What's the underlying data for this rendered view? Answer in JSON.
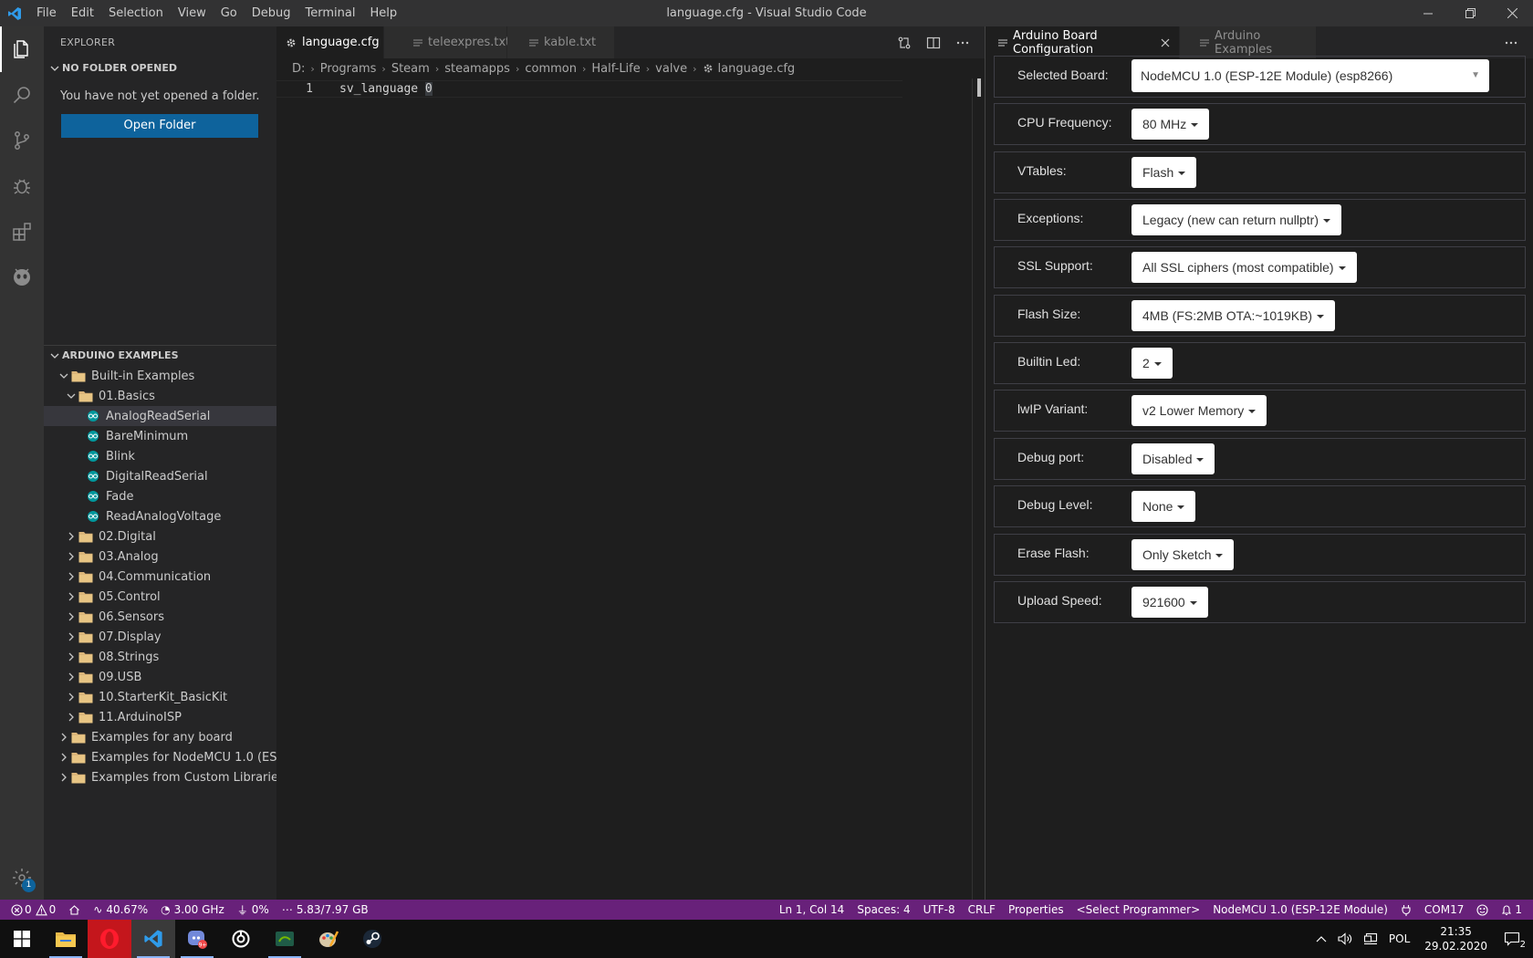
{
  "window": {
    "title": "language.cfg - Visual Studio Code",
    "menu": [
      "File",
      "Edit",
      "Selection",
      "View",
      "Go",
      "Debug",
      "Terminal",
      "Help"
    ]
  },
  "activity_bar": {
    "items": [
      "files-icon",
      "search-icon",
      "source-control-icon",
      "debug-icon",
      "extensions-icon",
      "platformio-icon"
    ],
    "settings_badge": "1"
  },
  "sidebar": {
    "title": "EXPLORER",
    "no_folder": {
      "header": "NO FOLDER OPENED",
      "message": "You have not yet opened a folder.",
      "button": "Open Folder"
    },
    "examples": {
      "header": "ARDUINO EXAMPLES",
      "tree": [
        {
          "label": "Built-in Examples",
          "depth": 0,
          "twisty": "open",
          "icon": "folder"
        },
        {
          "label": "01.Basics",
          "depth": 1,
          "twisty": "open",
          "icon": "folder"
        },
        {
          "label": "AnalogReadSerial",
          "depth": 2,
          "twisty": "none",
          "icon": "arduino",
          "selected": true
        },
        {
          "label": "BareMinimum",
          "depth": 2,
          "twisty": "none",
          "icon": "arduino"
        },
        {
          "label": "Blink",
          "depth": 2,
          "twisty": "none",
          "icon": "arduino"
        },
        {
          "label": "DigitalReadSerial",
          "depth": 2,
          "twisty": "none",
          "icon": "arduino"
        },
        {
          "label": "Fade",
          "depth": 2,
          "twisty": "none",
          "icon": "arduino"
        },
        {
          "label": "ReadAnalogVoltage",
          "depth": 2,
          "twisty": "none",
          "icon": "arduino"
        },
        {
          "label": "02.Digital",
          "depth": 1,
          "twisty": "closed",
          "icon": "folder"
        },
        {
          "label": "03.Analog",
          "depth": 1,
          "twisty": "closed",
          "icon": "folder"
        },
        {
          "label": "04.Communication",
          "depth": 1,
          "twisty": "closed",
          "icon": "folder"
        },
        {
          "label": "05.Control",
          "depth": 1,
          "twisty": "closed",
          "icon": "folder"
        },
        {
          "label": "06.Sensors",
          "depth": 1,
          "twisty": "closed",
          "icon": "folder"
        },
        {
          "label": "07.Display",
          "depth": 1,
          "twisty": "closed",
          "icon": "folder"
        },
        {
          "label": "08.Strings",
          "depth": 1,
          "twisty": "closed",
          "icon": "folder"
        },
        {
          "label": "09.USB",
          "depth": 1,
          "twisty": "closed",
          "icon": "folder"
        },
        {
          "label": "10.StarterKit_BasicKit",
          "depth": 1,
          "twisty": "closed",
          "icon": "folder"
        },
        {
          "label": "11.ArduinoISP",
          "depth": 1,
          "twisty": "closed",
          "icon": "folder"
        },
        {
          "label": "Examples for any board",
          "depth": 0,
          "twisty": "closed",
          "icon": "folder"
        },
        {
          "label": "Examples for NodeMCU 1.0 (ES...",
          "depth": 0,
          "twisty": "closed",
          "icon": "folder"
        },
        {
          "label": "Examples from Custom Libraries",
          "depth": 0,
          "twisty": "closed",
          "icon": "folder"
        }
      ]
    }
  },
  "editor": {
    "tabs": [
      {
        "label": "language.cfg",
        "icon": "gear-icon",
        "active": true
      },
      {
        "label": "teleexpres.txt",
        "icon": "lines-icon",
        "active": false
      },
      {
        "label": "kable.txt",
        "icon": "lines-icon",
        "active": false
      }
    ],
    "breadcrumbs": [
      "D:",
      "Programs",
      "Steam",
      "steamapps",
      "common",
      "Half-Life",
      "valve"
    ],
    "breadcrumb_file": "language.cfg",
    "lines": [
      {
        "number": "1",
        "text": "sv_language ",
        "cursor_char": "0"
      }
    ]
  },
  "board_config": {
    "tabs": [
      {
        "label": "Arduino Board Configuration",
        "active": true
      },
      {
        "label": "Arduino Examples",
        "active": false
      }
    ],
    "rows": [
      {
        "label": "Selected Board:",
        "value": "NodeMCU 1.0 (ESP-12E Module) (esp8266)"
      },
      {
        "label": "CPU Frequency:",
        "value": "80 MHz"
      },
      {
        "label": "VTables:",
        "value": "Flash"
      },
      {
        "label": "Exceptions:",
        "value": "Legacy (new can return nullptr)"
      },
      {
        "label": "SSL Support:",
        "value": "All SSL ciphers (most compatible)"
      },
      {
        "label": "Flash Size:",
        "value": "4MB (FS:2MB OTA:~1019KB)"
      },
      {
        "label": "Builtin Led:",
        "value": "2"
      },
      {
        "label": "lwIP Variant:",
        "value": "v2 Lower Memory"
      },
      {
        "label": "Debug port:",
        "value": "Disabled"
      },
      {
        "label": "Debug Level:",
        "value": "None"
      },
      {
        "label": "Erase Flash:",
        "value": "Only Sketch"
      },
      {
        "label": "Upload Speed:",
        "value": "921600"
      }
    ]
  },
  "status_bar": {
    "errors": "0",
    "warnings": "0",
    "cpu_load": "40.67%",
    "cpu_freq": "3.00 GHz",
    "power": "0%",
    "memory": "5.83/7.97 GB",
    "cursor": "Ln 1, Col 14",
    "spaces": "Spaces: 4",
    "encoding": "UTF-8",
    "eol": "CRLF",
    "language": "Properties",
    "programmer": "<Select Programmer>",
    "board": "NodeMCU 1.0 (ESP-12E Module)",
    "port": "COM17",
    "notifications": "1",
    "color": "#68217a"
  },
  "taskbar": {
    "apps": [
      "windows-start-icon",
      "file-explorer-icon",
      "opera-icon",
      "vscode-icon",
      "discord-icon",
      "steelseries-icon",
      "nvidia-icon",
      "paint-icon",
      "steam-icon"
    ],
    "language": "POL",
    "time": "21:35",
    "date": "29.02.2020",
    "action_center_count": "2"
  }
}
